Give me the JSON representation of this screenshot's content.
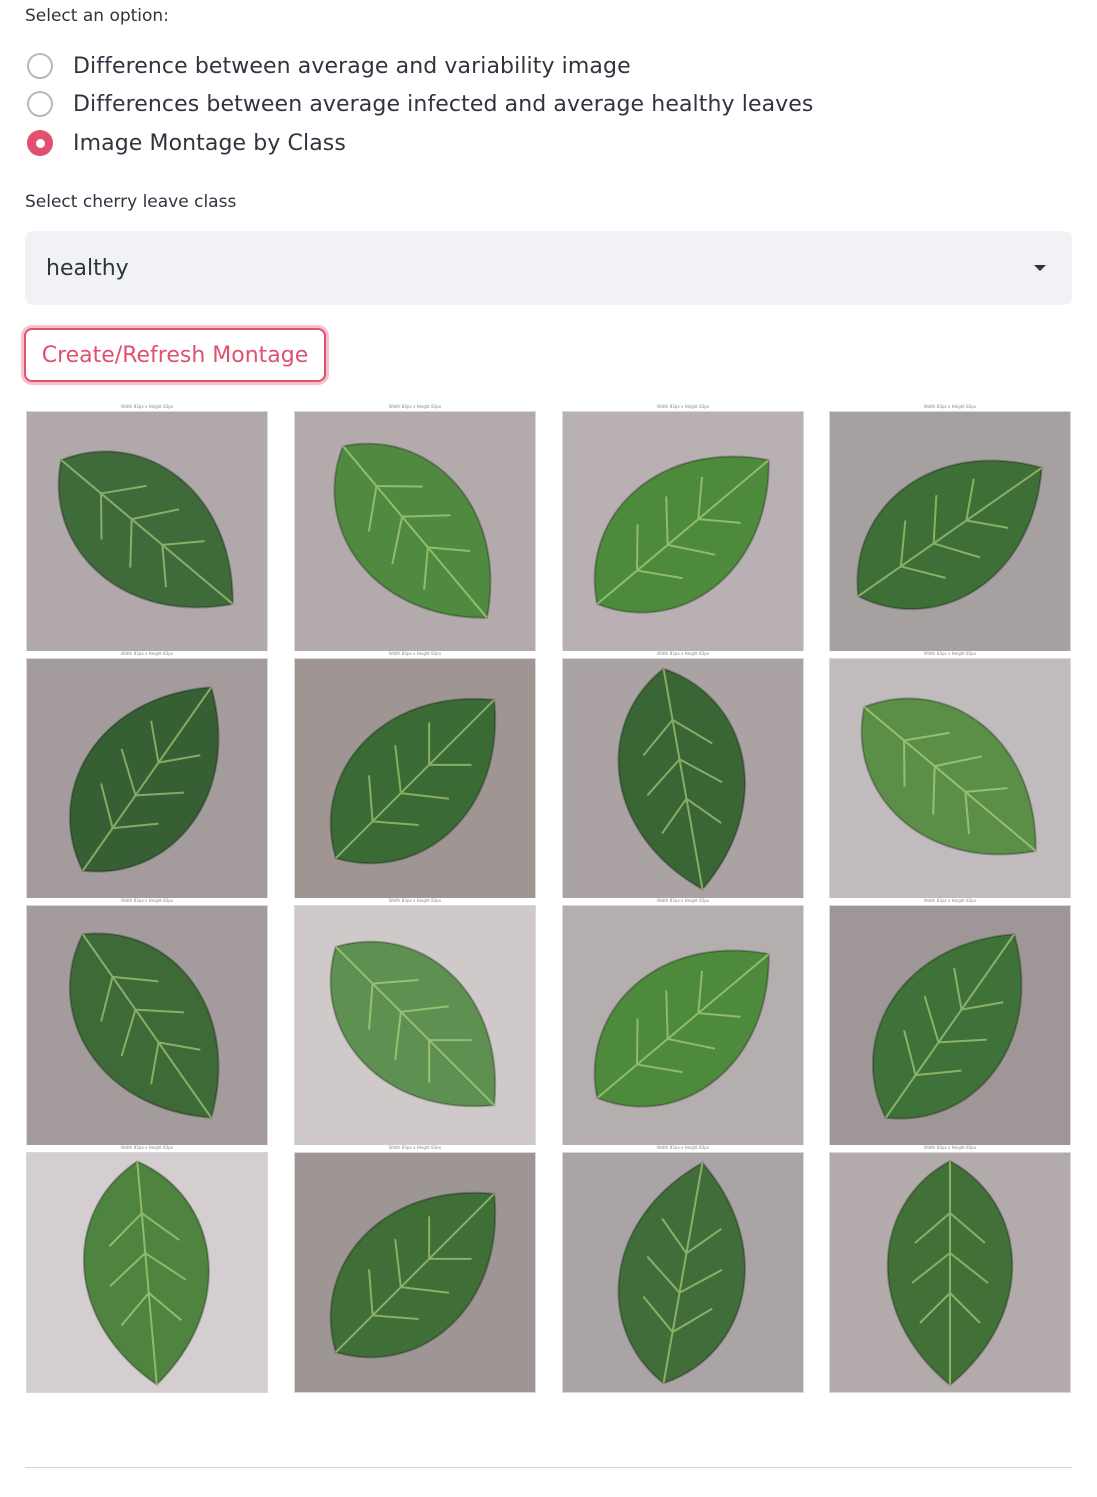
{
  "radio": {
    "label": "Select an option:",
    "options": [
      {
        "label": "Difference between average and variability image",
        "checked": false
      },
      {
        "label": "Differences between average infected and average healthy leaves",
        "checked": false
      },
      {
        "label": "Image Montage by Class",
        "checked": true
      }
    ]
  },
  "select": {
    "label": "Select cherry leave class",
    "value": "healthy",
    "icon": "chevron-down-icon"
  },
  "button": {
    "label": "Create/Refresh Montage"
  },
  "colors": {
    "accent": "#e0506f",
    "select_bg": "#f0f2f6",
    "text": "#31333f"
  },
  "montage": {
    "caption": "Width 83px x Height 83px",
    "tiles": [
      {
        "bg": "#b0a8ab",
        "leaf": "#3f6b3a",
        "rot": 40
      },
      {
        "bg": "#b3abab",
        "leaf": "#4f8a40",
        "rot": 50
      },
      {
        "bg": "#b8b0b2",
        "leaf": "#4e8a3c",
        "rot": -40
      },
      {
        "bg": "#a7a0a1",
        "leaf": "#3e6f36",
        "rot": -35
      },
      {
        "bg": "#a49c9c",
        "leaf": "#365f33",
        "rot": -55
      },
      {
        "bg": "#9f9694",
        "leaf": "#3b6b34",
        "rot": -45
      },
      {
        "bg": "#aaa2a3",
        "leaf": "#3a6635",
        "rot": 80
      },
      {
        "bg": "#c2bbbd",
        "leaf": "#5b8f47",
        "rot": 40
      },
      {
        "bg": "#a39b9c",
        "leaf": "#3e6a37",
        "rot": 55
      },
      {
        "bg": "#cfc9ca",
        "leaf": "#5e9151",
        "rot": 45
      },
      {
        "bg": "#b5aeaf",
        "leaf": "#4e8a3b",
        "rot": -40
      },
      {
        "bg": "#9f9797",
        "leaf": "#3f7238",
        "rot": -55
      },
      {
        "bg": "#d4ced0",
        "leaf": "#4e843f",
        "rot": 85
      },
      {
        "bg": "#9e9595",
        "leaf": "#3f6e36",
        "rot": -45
      },
      {
        "bg": "#aba4a6",
        "leaf": "#406d39",
        "rot": -80
      },
      {
        "bg": "#b2aaab",
        "leaf": "#427138",
        "rot": 90
      }
    ]
  }
}
